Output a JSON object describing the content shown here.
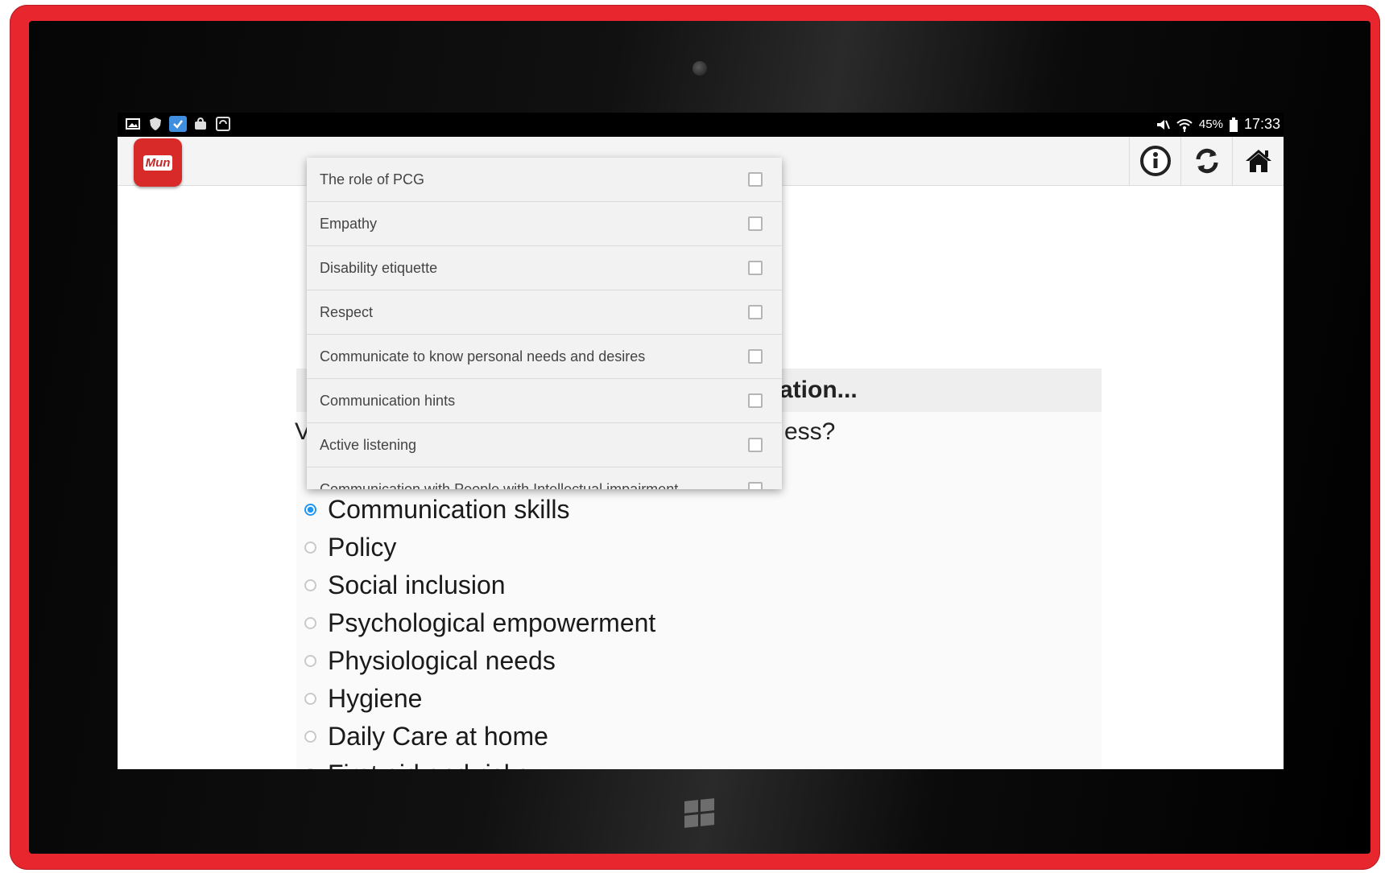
{
  "status_bar": {
    "left_icons": [
      "image-icon",
      "shield-icon",
      "checkbox-icon",
      "bag-icon",
      "sync-icon"
    ],
    "battery": "45%",
    "time": "17:33"
  },
  "app_bar": {
    "logo_text": "Mun",
    "buttons": [
      "info-icon",
      "refresh-icon",
      "home-icon"
    ]
  },
  "dropdown": {
    "items": [
      {
        "label": "The role of PCG",
        "checked": false
      },
      {
        "label": "Empathy",
        "checked": false
      },
      {
        "label": "Disability etiquette",
        "checked": false
      },
      {
        "label": "Respect",
        "checked": false
      },
      {
        "label": "Communicate to know personal needs and desires",
        "checked": false
      },
      {
        "label": "Communication hints",
        "checked": false
      },
      {
        "label": "Active listening",
        "checked": false
      },
      {
        "label": "Communication with People with Intellectual impairment",
        "checked": false
      }
    ]
  },
  "main": {
    "section_title_visible": "ation...",
    "question_start_visible": "V",
    "question_end_visible": "ess?",
    "options": [
      {
        "label": "Communication skills",
        "selected": true
      },
      {
        "label": "Policy",
        "selected": false
      },
      {
        "label": "Social inclusion",
        "selected": false
      },
      {
        "label": "Psychological empowerment",
        "selected": false
      },
      {
        "label": "Physiological needs",
        "selected": false
      },
      {
        "label": "Hygiene",
        "selected": false
      },
      {
        "label": "Daily Care at home",
        "selected": false
      },
      {
        "label": "First aid and risks",
        "selected": false
      }
    ]
  },
  "colors": {
    "bezel": "#e8262e",
    "accent_radio": "#2196f3",
    "logo_bg": "#d92a2a"
  }
}
